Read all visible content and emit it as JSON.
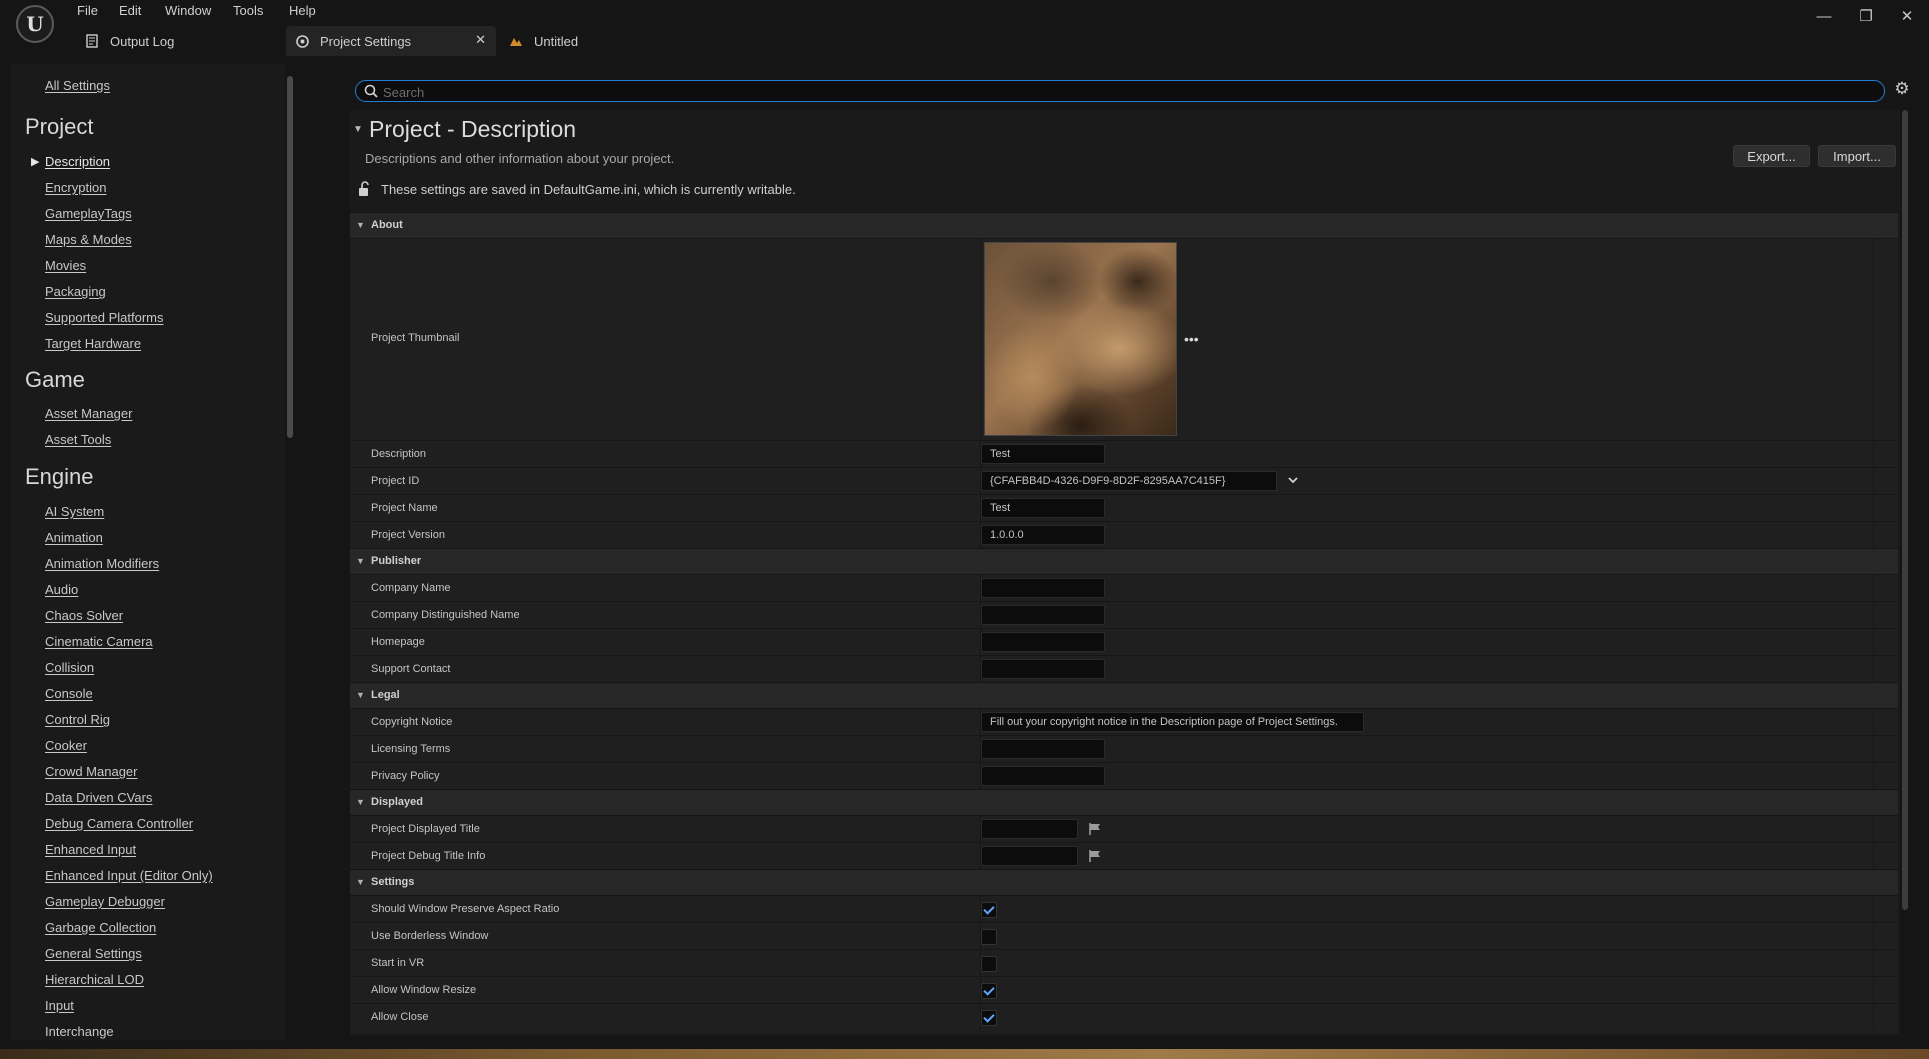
{
  "menu": [
    "File",
    "Edit",
    "Window",
    "Tools",
    "Help"
  ],
  "tabs": {
    "output_log": "Output Log",
    "project_settings": "Project Settings",
    "untitled": "Untitled"
  },
  "window_controls": {
    "minimize": "—",
    "restore": "❐",
    "close": "✕"
  },
  "sidebar": {
    "all_settings": "All Settings",
    "project_heading": "Project",
    "project_items": [
      "Description",
      "Encryption",
      "GameplayTags",
      "Maps & Modes",
      "Movies",
      "Packaging",
      "Supported Platforms",
      "Target Hardware"
    ],
    "game_heading": "Game",
    "game_items": [
      "Asset Manager",
      "Asset Tools"
    ],
    "engine_heading": "Engine",
    "engine_items": [
      "AI System",
      "Animation",
      "Animation Modifiers",
      "Audio",
      "Chaos Solver",
      "Cinematic Camera",
      "Collision",
      "Console",
      "Control Rig",
      "Cooker",
      "Crowd Manager",
      "Data Driven CVars",
      "Debug Camera Controller",
      "Enhanced Input",
      "Enhanced Input (Editor Only)",
      "Gameplay Debugger",
      "Garbage Collection",
      "General Settings",
      "Hierarchical LOD",
      "Input",
      "Interchange"
    ]
  },
  "search": {
    "placeholder": "Search",
    "value": ""
  },
  "panel": {
    "title": "Project - Description",
    "subtitle": "Descriptions and other information about your project.",
    "config_note": "These settings are saved in DefaultGame.ini, which is currently writable.",
    "export_label": "Export...",
    "import_label": "Import..."
  },
  "sections": {
    "about": "About",
    "publisher": "Publisher",
    "legal": "Legal",
    "displayed": "Displayed",
    "settings": "Settings"
  },
  "about": {
    "thumbnail_label": "Project Thumbnail",
    "thumbnail_more": "•••",
    "description_label": "Description",
    "description_value": "Test",
    "project_id_label": "Project ID",
    "project_id_value": "{CFAFBB4D-4326-D9F9-8D2F-8295AA7C415F}",
    "project_name_label": "Project Name",
    "project_name_value": "Test",
    "project_version_label": "Project Version",
    "project_version_value": "1.0.0.0"
  },
  "publisher": {
    "company_name_label": "Company Name",
    "company_distinguished_label": "Company Distinguished Name",
    "homepage_label": "Homepage",
    "support_contact_label": "Support Contact"
  },
  "legal": {
    "copyright_label": "Copyright Notice",
    "copyright_value": "Fill out your copyright notice in the Description page of Project Settings.",
    "licensing_label": "Licensing Terms",
    "privacy_label": "Privacy Policy"
  },
  "displayed": {
    "displayed_title_label": "Project Displayed Title",
    "debug_title_label": "Project Debug Title Info"
  },
  "settings": {
    "items": [
      {
        "label": "Should Window Preserve Aspect Ratio",
        "checked": true
      },
      {
        "label": "Use Borderless Window",
        "checked": false
      },
      {
        "label": "Start in VR",
        "checked": false
      },
      {
        "label": "Allow Window Resize",
        "checked": true
      },
      {
        "label": "Allow Close",
        "checked": true
      }
    ]
  },
  "colors": {
    "accent": "#1f7fd6",
    "check": "#5fa7ff",
    "background": "#151515"
  },
  "icons": [
    "unreal-logo-icon",
    "output-log-icon",
    "project-settings-icon",
    "level-icon",
    "search-icon",
    "gear-icon",
    "lock-open-icon",
    "flag-icon",
    "chevron-down-icon",
    "caret-right-icon",
    "caret-down-icon"
  ]
}
